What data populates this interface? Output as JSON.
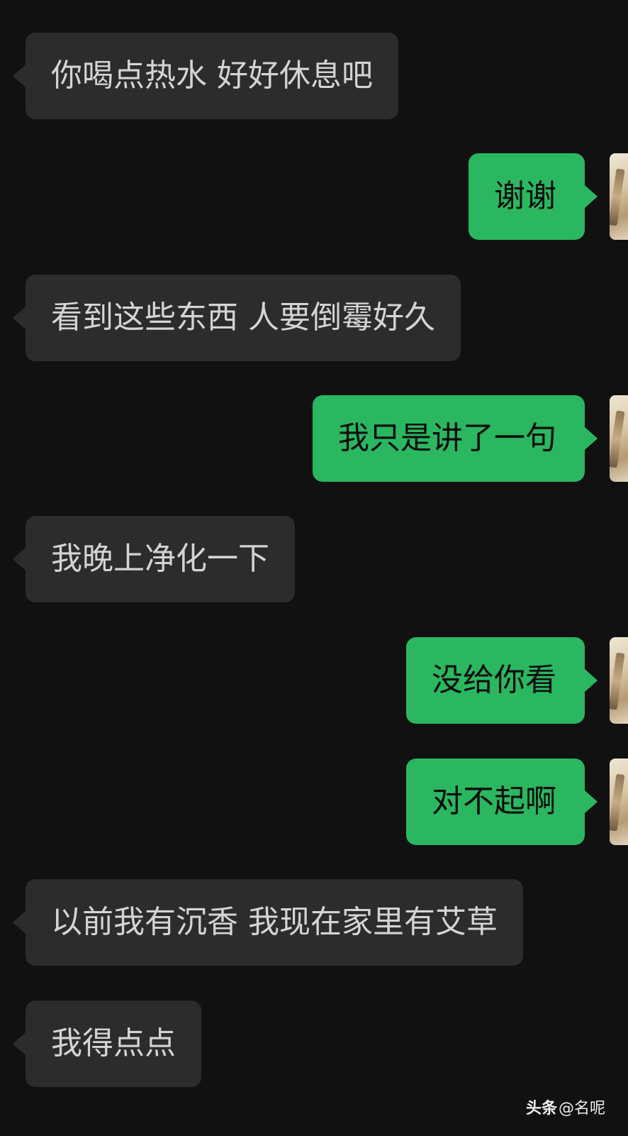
{
  "messages": [
    {
      "side": "in",
      "text": "你喝点热水 好好休息吧"
    },
    {
      "side": "out",
      "text": "谢谢"
    },
    {
      "side": "in",
      "text": "看到这些东西 人要倒霉好久"
    },
    {
      "side": "out",
      "text": "我只是讲了一句"
    },
    {
      "side": "in",
      "text": "我晚上净化一下"
    },
    {
      "side": "out",
      "text": "没给你看"
    },
    {
      "side": "out",
      "text": "对不起啊"
    },
    {
      "side": "in",
      "text": "以前我有沉香 我现在家里有艾草"
    },
    {
      "side": "in",
      "text": "我得点点"
    }
  ],
  "watermark": {
    "brand": "头条",
    "handle": "@名呢"
  },
  "colors": {
    "background": "#111111",
    "incoming_bubble": "#2c2c2c",
    "outgoing_bubble": "#2ab760"
  }
}
